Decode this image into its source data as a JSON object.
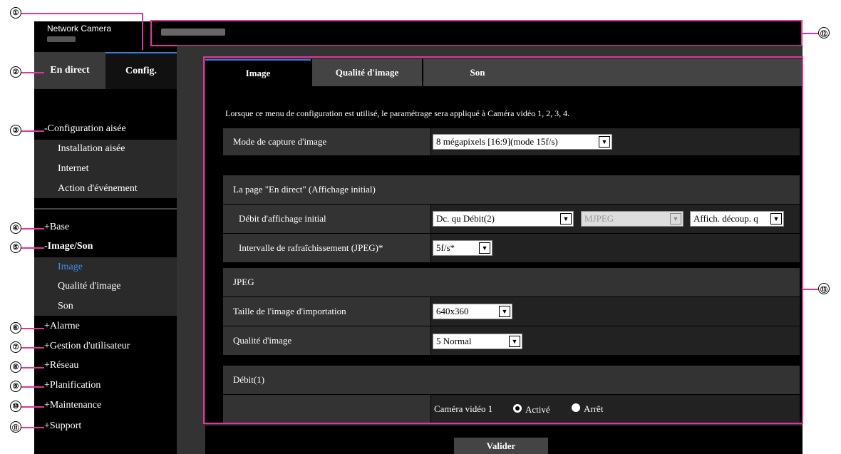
{
  "app": {
    "brand": "Network Camera"
  },
  "main_tabs": {
    "live": "En direct",
    "config": "Config."
  },
  "nav": {
    "easy_setup": "-Configuration aisée",
    "easy_setup_items": [
      "Installation aisée",
      "Internet",
      "Action d'événement"
    ],
    "base": "+Base",
    "image_audio": "-Image/Son",
    "image_audio_items": [
      "Image",
      "Qualité d'image",
      "Son"
    ],
    "alarm": "+Alarme",
    "user_mgmt": "+Gestion d'utilisateur",
    "network": "+Réseau",
    "schedule": "+Planification",
    "maintenance": "+Maintenance",
    "support": "+Support"
  },
  "callouts": [
    "①",
    "②",
    "③",
    "④",
    "⑤",
    "⑥",
    "⑦",
    "⑧",
    "⑨",
    "⑩",
    "⑪",
    "⑫",
    "⑬"
  ],
  "content_tabs": [
    "Image",
    "Qualité d'image",
    "Son"
  ],
  "note": "Lorsque ce menu de configuration est utilisé, le paramétrage sera appliqué à Caméra vidéo 1, 2, 3, 4.",
  "capture_mode": {
    "label": "Mode de capture d'image",
    "value": "8 mégapixels [16:9](mode 15f/s)"
  },
  "live_page": {
    "section": "La page \"En direct\" (Affichage initial)",
    "initial_stream_label": "Débit d'affichage initial",
    "initial_stream_value": "Dc. qu Débit(2)",
    "codec_value": "MJPEG",
    "crop_value": "Affich. découp. q",
    "refresh_label": "Intervalle de rafraîchissement (JPEG)*",
    "refresh_value": "5f/s*"
  },
  "jpeg": {
    "section": "JPEG",
    "size_label": "Taille de l'image d'importation",
    "size_value": "640x360",
    "quality_label": "Qualité d'image",
    "quality_value": "5 Normal"
  },
  "stream1": {
    "section": "Débit(1)",
    "camera_label": "Caméra vidéo 1",
    "on": "Activé",
    "off": "Arrêt"
  },
  "apply": "Valider",
  "colors": {
    "callout_line": "#e6339c",
    "active_link": "#3a8ee8",
    "tab_accent": "#3a7bd5"
  }
}
